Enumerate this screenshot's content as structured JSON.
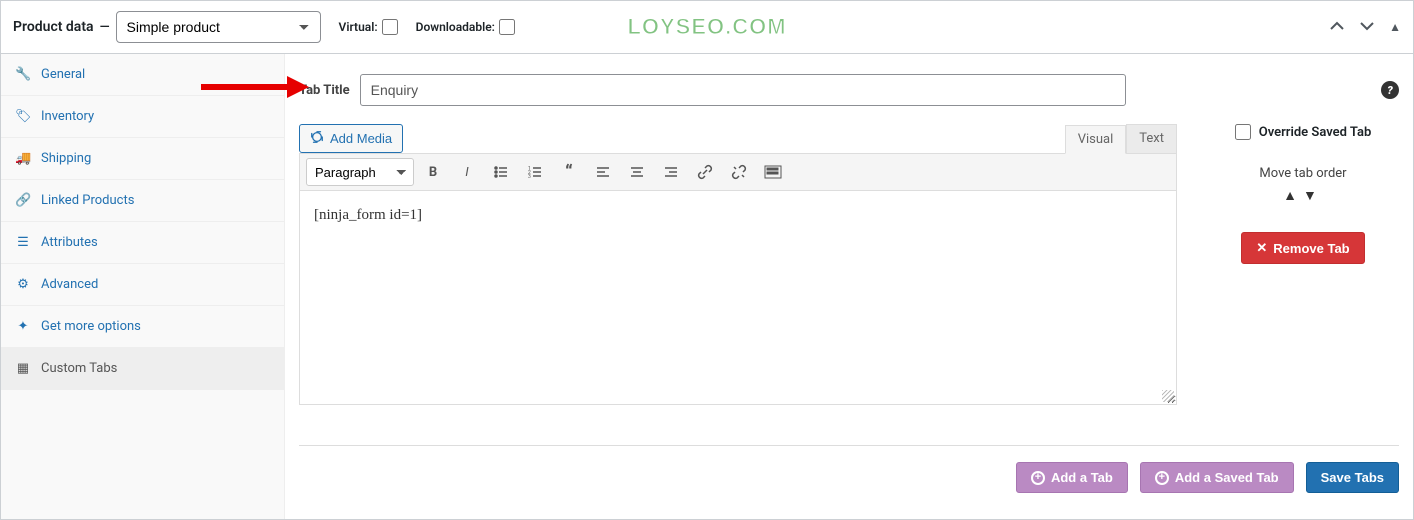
{
  "header": {
    "title": "Product data",
    "product_type": "Simple product",
    "virtual_label": "Virtual:",
    "downloadable_label": "Downloadable:",
    "watermark": "LOYSEO.COM"
  },
  "sidebar": {
    "items": [
      {
        "label": "General",
        "icon": "wrench-icon"
      },
      {
        "label": "Inventory",
        "icon": "tag-icon"
      },
      {
        "label": "Shipping",
        "icon": "truck-icon"
      },
      {
        "label": "Linked Products",
        "icon": "link-icon"
      },
      {
        "label": "Attributes",
        "icon": "list-icon"
      },
      {
        "label": "Advanced",
        "icon": "gear-icon"
      },
      {
        "label": "Get more options",
        "icon": "store-icon"
      },
      {
        "label": "Custom Tabs",
        "icon": "tabs-icon"
      }
    ]
  },
  "tab_form": {
    "title_label": "Tab Title",
    "title_value": "Enquiry",
    "add_media_label": "Add Media",
    "editor_tabs": {
      "visual": "Visual",
      "text": "Text"
    },
    "format_value": "Paragraph",
    "content": "[ninja_form id=1]",
    "override_label": "Override Saved Tab",
    "move_order_label": "Move tab order",
    "remove_label": "Remove Tab"
  },
  "footer": {
    "add_tab": "Add a Tab",
    "add_saved": "Add a Saved Tab",
    "save": "Save Tabs"
  }
}
